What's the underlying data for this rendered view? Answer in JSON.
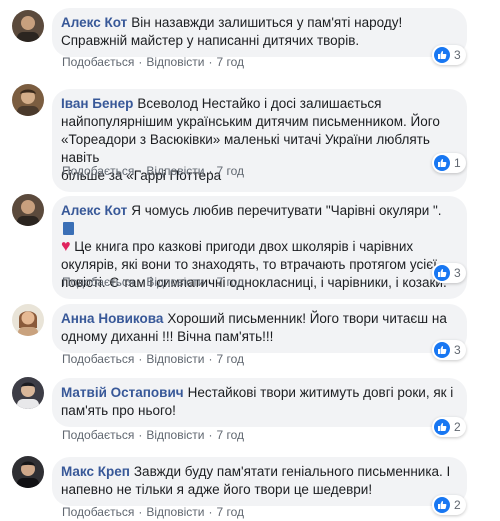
{
  "comments": [
    {
      "author": "Алекс Кот",
      "lines": [
        "Він назавжди залишиться у пам'яті народу!",
        "Справжній майстер у написанні дитячих творів."
      ],
      "like_label": "Подобається",
      "reply_label": "Відповісти",
      "time": "7 год",
      "reactions": "3",
      "avatar_colors": {
        "bg": "#5b4a3c",
        "face": "#c8a07e"
      }
    },
    {
      "author": "Іван Бенер",
      "lines": [
        "Всеволод Нестайко і досі залишається",
        "найпопулярнішим українським дитячим письменником. Його",
        "«Тореадори з Васюківки» маленькі читачі України люблять навіть",
        "більше за «Гаррі Поттера"
      ],
      "like_label": "Подобається",
      "reply_label": "Відповісти",
      "time": "7 год",
      "reactions": "1",
      "avatar_colors": {
        "bg": "#7b5d40",
        "face": "#d4ae8a"
      }
    },
    {
      "author": "Алекс Кот",
      "line1_text": "Я чомусь любив перечитувати \"Чарівні окуляри \".",
      "line2_text": "Це книга про казкові пригоди двох школярів і чарівних",
      "lines_rest": [
        "окулярів, які вони то знаходять, то втрачають протягом усієї",
        "повісті. Є там і симпатичні однокласниці, і чарівники, і козаки."
      ],
      "like_label": "Подобається",
      "reply_label": "Відповісти",
      "time": "7 год",
      "reactions": "3",
      "avatar_colors": {
        "bg": "#5b4a3c",
        "face": "#c8a07e"
      }
    },
    {
      "author": "Анна Новикова",
      "lines": [
        "Хороший письменник! Його твори читаєш на",
        "одному диханні !!! Вічна пам'ять!!!"
      ],
      "like_label": "Подобається",
      "reply_label": "Відповісти",
      "time": "7 год",
      "reactions": "3",
      "avatar_colors": {
        "bg": "#e9e4d8",
        "face": "#e6b993"
      }
    },
    {
      "author": "Матвій Остапович",
      "lines": [
        "Нестайкові твори житимуть довгі роки, як і",
        "пам'ять про нього!"
      ],
      "like_label": "Подобається",
      "reply_label": "Відповісти",
      "time": "7 год",
      "reactions": "2",
      "avatar_colors": {
        "bg": "#3d3d46",
        "face": "#d9b79a"
      }
    },
    {
      "author": "Макс Креп",
      "lines": [
        "Завжди буду пам'ятати геніального письменника. І",
        "напевно не тільки я адже його твори це шедеври!"
      ],
      "like_label": "Подобається",
      "reply_label": "Відповісти",
      "time": "7 год",
      "reactions": "2",
      "avatar_colors": {
        "bg": "#2f2f33",
        "face": "#cfa88a"
      }
    }
  ],
  "icons": {
    "like": "thumbs-up-icon",
    "book": "blue-book-icon",
    "heart": "red-heart-icon"
  },
  "colors": {
    "author": "#385898",
    "bubble": "#f2f3f5",
    "like_badge": "#1877f2"
  }
}
